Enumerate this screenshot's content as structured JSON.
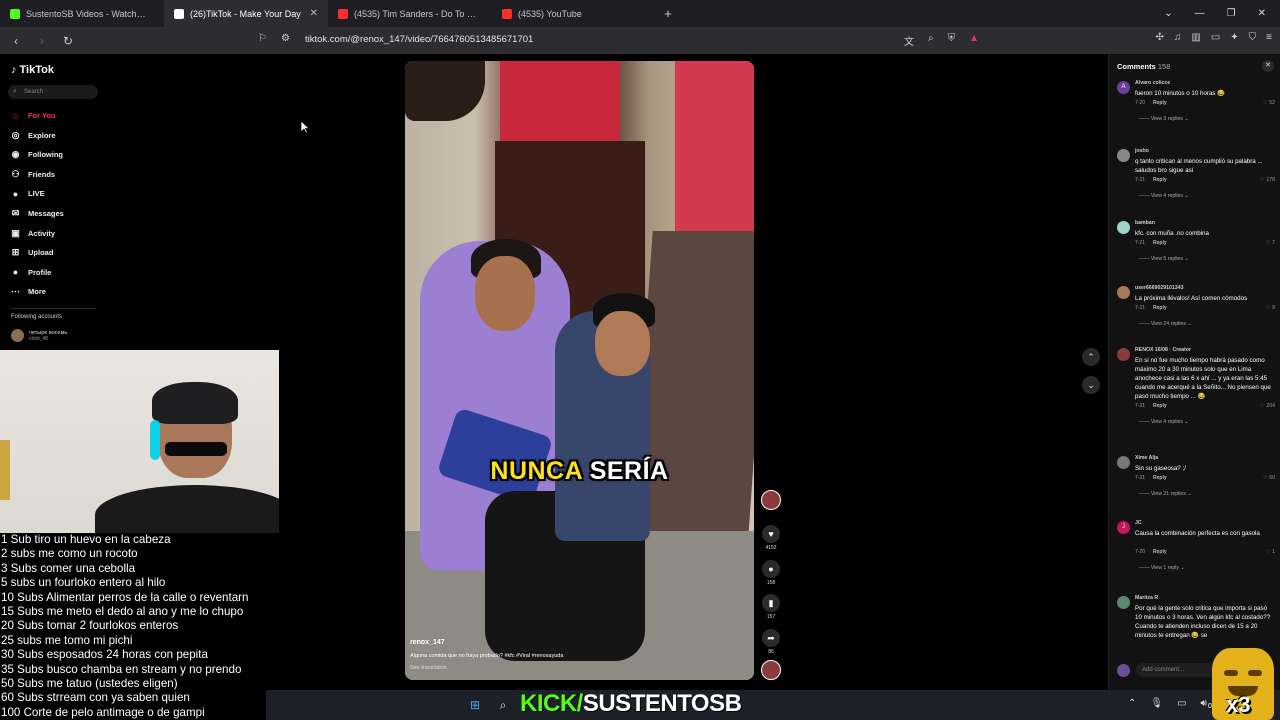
{
  "browser": {
    "tabs": [
      {
        "title": "SustentoSB Videos - Watch On-Dem",
        "color": "#53fc18",
        "active": false,
        "close": ""
      },
      {
        "title": "(26)TikTok - Make Your Day",
        "color": "#ffffff",
        "active": true,
        "close": "✕"
      },
      {
        "title": "(4535) Tim Sanders - Do To Me (Exte",
        "color": "#ff2d2d",
        "active": false,
        "close": ""
      },
      {
        "title": "(4535) YouTube",
        "color": "#ff2d2d",
        "active": false,
        "close": ""
      }
    ],
    "new_tab": "+",
    "url": "tiktok.com/@renox_147/video/7664760513485671701"
  },
  "tiktok": {
    "logo": "TikTok",
    "search_placeholder": "Search",
    "nav": [
      {
        "label": "For You",
        "icon": "home-icon",
        "glyph": "⌂",
        "active": true
      },
      {
        "label": "Explore",
        "icon": "compass-icon",
        "glyph": "◎",
        "active": false
      },
      {
        "label": "Following",
        "icon": "following-icon",
        "glyph": "◉",
        "active": false
      },
      {
        "label": "Friends",
        "icon": "friends-icon",
        "glyph": "⚇",
        "active": false
      },
      {
        "label": "LIVE",
        "icon": "live-icon",
        "glyph": "●",
        "active": false
      },
      {
        "label": "Messages",
        "icon": "messages-icon",
        "glyph": "✉",
        "active": false
      },
      {
        "label": "Activity",
        "icon": "activity-icon",
        "glyph": "▣",
        "active": false
      },
      {
        "label": "Upload",
        "icon": "upload-icon",
        "glyph": "⊞",
        "active": false
      },
      {
        "label": "Profile",
        "icon": "profile-icon",
        "glyph": "●",
        "active": false
      },
      {
        "label": "More",
        "icon": "more-icon",
        "glyph": "⋯",
        "active": false
      }
    ],
    "following_header": "Following accounts",
    "following_account": {
      "name": "четыре восемь",
      "handle": "cheti_48"
    }
  },
  "subs": [
    "1 Sub tiro un huevo en la cabeza",
    "2 subs me como un rocoto",
    "3 Subs comer una cebolla",
    "5 subs un fourloko entero al hilo",
    "10 Subs Alimentar perros de la calle o reventarn",
    "15 Subs me meto el dedo al ano y me lo chupo",
    "20 Subs tomar 2 fourlokos enteros",
    "25 subs me tomo mi pichi",
    "30 Subs esposados 24 horas con pepita",
    "35 Subs busco chamba en stream y no prendo",
    "50 Subs me tatuo (ustedes eligen)",
    "60 Subs strream con ya saben quien",
    "100 Corte de pelo antimage o de gampi"
  ],
  "video": {
    "caption_yellow": "NUNCA",
    "caption_white": "SERÍA",
    "author": "renox_147",
    "description": "Alguna comida que no haya probado? #kfc #Viral #renoxayuda",
    "see_translation": "See translation",
    "likes": "4152",
    "comments": "158",
    "saves": "157",
    "shares": "86"
  },
  "comments_panel": {
    "title": "Comments",
    "count": "158",
    "add_placeholder": "Add comment...",
    "items": [
      {
        "user": "Alvaro colicce",
        "avatar": "A",
        "avcolor": "#6b3fa0",
        "text": "fueron 10 minutos o 10 horas 😂",
        "time": "7-20",
        "likes": "52",
        "replies": "View 3 replies",
        "lines": 1
      },
      {
        "user": "josho",
        "avatar": "",
        "avcolor": "#888888",
        "text": "q tanto critican al menos cumplió su palabra ... saludos bro sigue así",
        "time": "7-21",
        "likes": "178",
        "replies": "View 4 replies",
        "lines": 2
      },
      {
        "user": "bamban",
        "avatar": "",
        "avcolor": "#9fd3c7",
        "text": "kfc. con muña .no combina",
        "time": "7-21",
        "likes": "7",
        "replies": "View 5 replies",
        "lines": 1
      },
      {
        "user": "user6669029101343",
        "avatar": "",
        "avcolor": "#a57a5a",
        "text": "La próxima llévalos! Así comen cómodos",
        "time": "7-21",
        "likes": "9",
        "replies": "View 24 replies",
        "lines": 1
      },
      {
        "user": "RENOX 16/08 · Creator",
        "avatar": "",
        "avcolor": "#8a3b3b",
        "text": "En si no fue mucho tiempo habrá pasado como máximo 20 a 30 minutos solo que en Lima anochece casi a las 6 x ahí ... y ya eran las 5:45 cuando me acerqué a la Señito... No piensen que pasó mucho tiempo ... 😂",
        "time": "7-21",
        "likes": "204",
        "replies": "View 4 replies",
        "lines": 5
      },
      {
        "user": "Xime Alja",
        "avatar": "",
        "avcolor": "#777777",
        "text": "Sin su gaseosa? ;/",
        "time": "7-21",
        "likes": "50",
        "replies": "View 21 replies",
        "lines": 1
      },
      {
        "user": "JC",
        "avatar": "J",
        "avcolor": "#c2185b",
        "text": "Causa la combinación perfecta es con gasola",
        "time": "7-20",
        "likes": "1",
        "replies": "View 1 reply",
        "lines": 2
      },
      {
        "user": "Maritza R",
        "avatar": "",
        "avcolor": "#5a8a6b",
        "text": "Por qué la gente solo critica que importa si pasó 10 minutos o 3 horas. Ven algún kfc al costado?? Cuando te atienden incluso dicen de 15 a 20 minutos te entregan 😂 se",
        "time": "",
        "likes": "",
        "replies": "",
        "lines": 4
      }
    ]
  },
  "overlay": {
    "kick_green": "KICK/",
    "kick_white": "SUSTENTOSB",
    "badge": "x3",
    "clock": "07/0"
  }
}
